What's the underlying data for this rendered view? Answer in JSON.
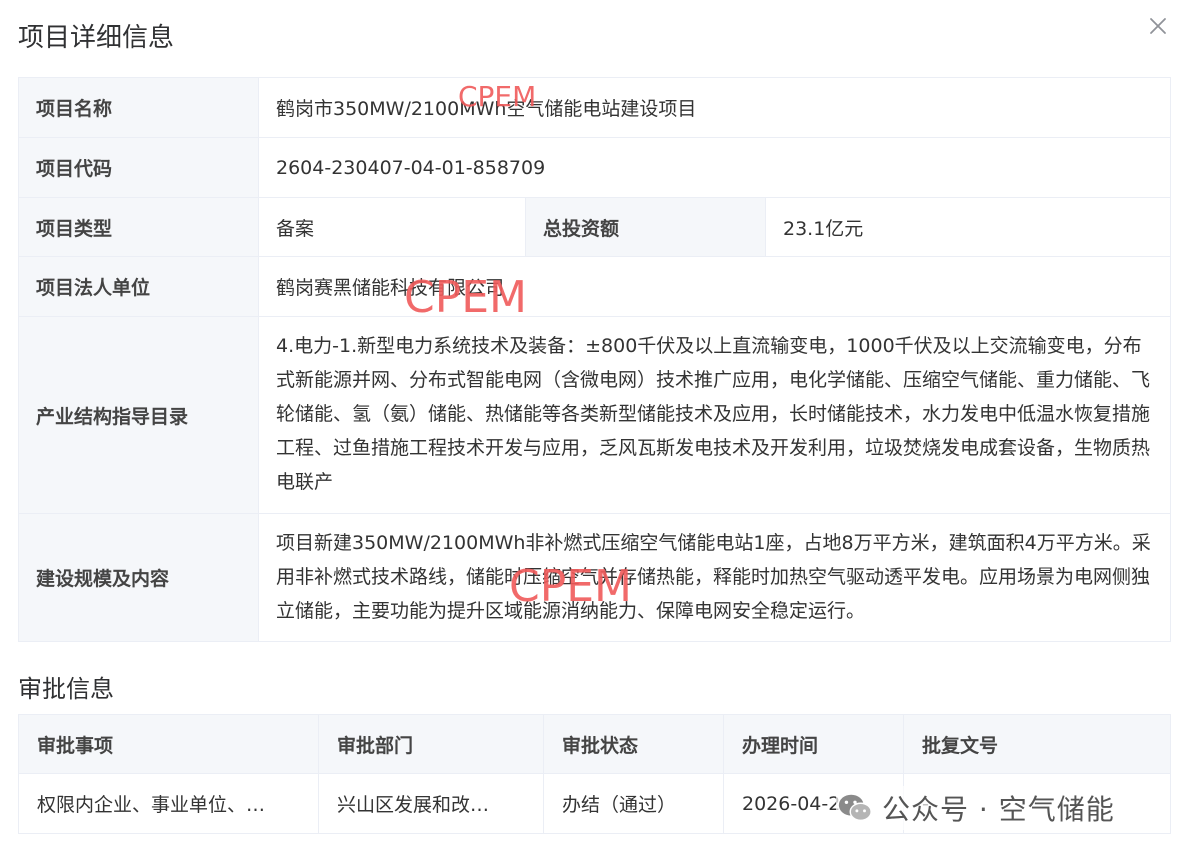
{
  "dialog": {
    "title": "项目详细信息"
  },
  "project": {
    "name_label": "项目名称",
    "name_value": "鹤岗市350MW/2100MWh空气储能电站建设项目",
    "code_label": "项目代码",
    "code_value": "2604-230407-04-01-858709",
    "type_label": "项目类型",
    "type_value": "备案",
    "investment_label": "总投资额",
    "investment_value": "23.1亿元",
    "entity_label": "项目法人单位",
    "entity_value": "鹤岗赛黑储能科技有限公司",
    "catalog_label": "产业结构指导目录",
    "catalog_value": "4.电力-1.新型电力系统技术及装备：±800千伏及以上直流输变电，1000千伏及以上交流输变电，分布式新能源并网、分布式智能电网（含微电网）技术推广应用，电化学储能、压缩空气储能、重力储能、飞轮储能、氢（氨）储能、热储能等各类新型储能技术及应用，长时储能技术，水力发电中低温水恢复措施工程、过鱼措施工程技术开发与应用，乏风瓦斯发电技术及开发利用，垃圾焚烧发电成套设备，生物质热电联产",
    "scale_label": "建设规模及内容",
    "scale_value": "项目新建350MW/2100MWh非补燃式压缩空气储能电站1座，占地8万平方米，建筑面积4万平方米。采用非补燃式技术路线，储能时压缩空气并存储热能，释能时加热空气驱动透平发电。应用场景为电网侧独立储能，主要功能为提升区域能源消纳能力、保障电网安全稳定运行。"
  },
  "approval": {
    "title": "审批信息",
    "headers": [
      "审批事项",
      "审批部门",
      "审批状态",
      "办理时间",
      "批复文号"
    ],
    "rows": [
      [
        "权限内企业、事业单位、…",
        "兴山区发展和改…",
        "办结（通过）",
        "2026-04-29",
        "-"
      ]
    ]
  },
  "watermarks": {
    "text1": "CPEM",
    "text2": "CPEM",
    "text3": "CPEM"
  },
  "badge": {
    "text": "公众号 · 空气储能",
    "icon": "wechat-icon"
  },
  "colors": {
    "label_bg": "#f5f7fa",
    "border": "#ebeef5",
    "watermark": "#f05a5a"
  }
}
